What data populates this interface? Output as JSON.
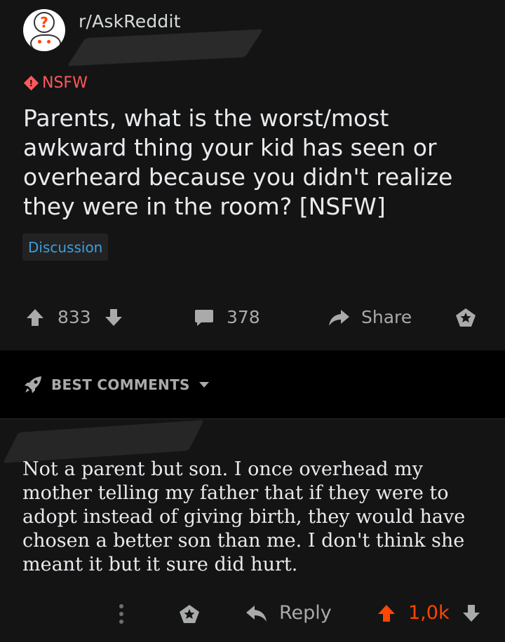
{
  "subreddit": {
    "name": "r/AskReddit",
    "avatar_icon": "question-snoo-icon"
  },
  "post": {
    "nsfw_label": "NSFW",
    "title": "Parents, what is the worst/most awkward thing your kid has seen or overheard because you didn't realize they were in the room? [NSFW]",
    "flair": "Discussion",
    "upvotes": "833",
    "comments": "378",
    "share_label": "Share"
  },
  "comments_section": {
    "sort_label": "BEST COMMENTS"
  },
  "comment": {
    "body": "Not a parent but son. I once overhead my mother telling my father that if they were to adopt instead of giving birth, they would have chosen a better son than me. I don't think she meant it but it sure did hurt.",
    "reply_label": "Reply",
    "score": "1,0k"
  },
  "colors": {
    "background": "#141414",
    "nsfw": "#ff585b",
    "flair_text": "#3d9fe0",
    "upvote_accent": "#ff4500",
    "muted": "#a8aaab"
  }
}
